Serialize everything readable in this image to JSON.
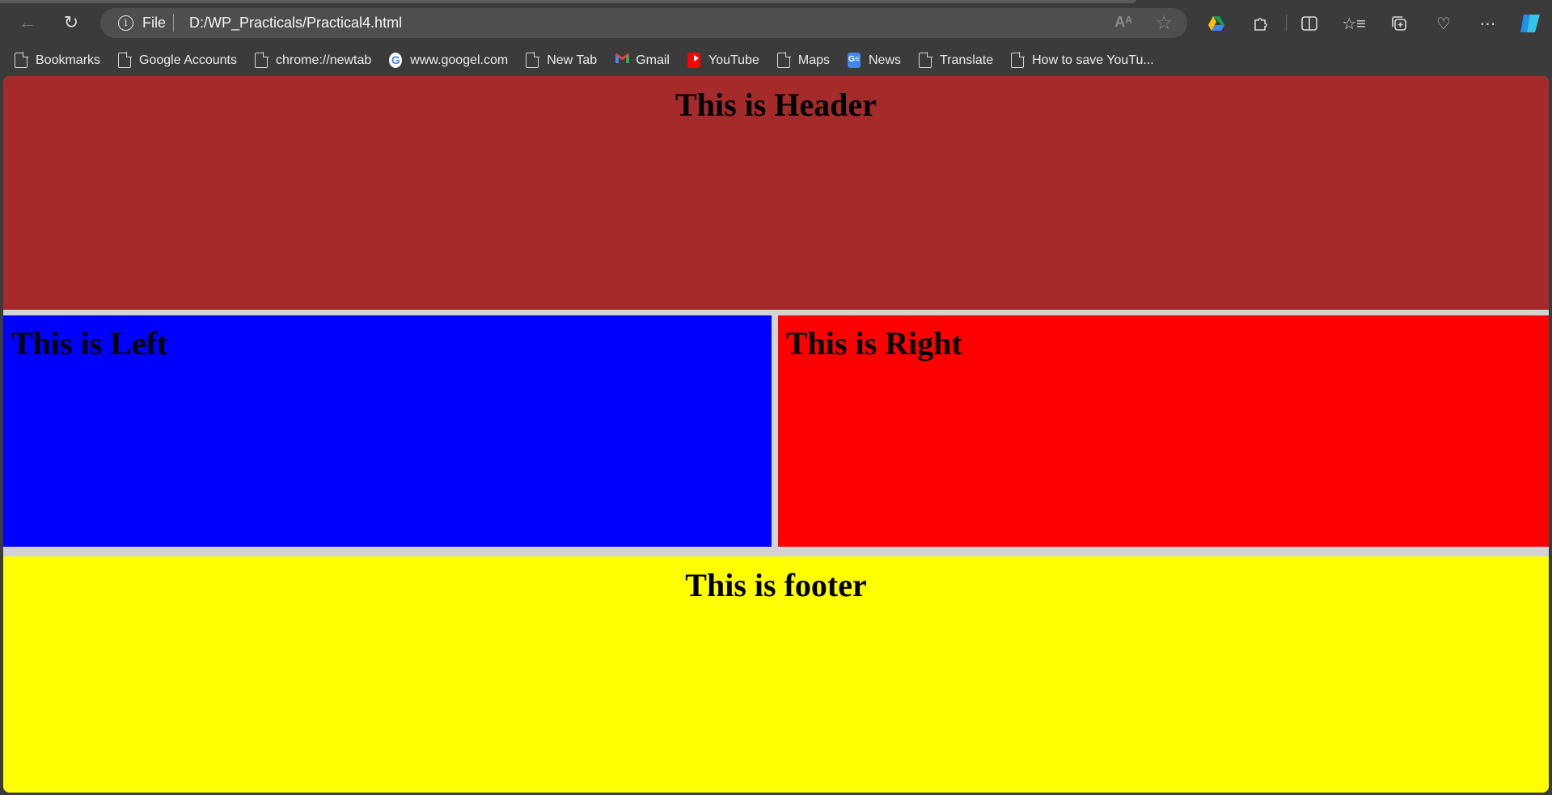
{
  "browser": {
    "address": {
      "scheme_label": "File",
      "url": "D:/WP_Practicals/Practical4.html"
    },
    "read_aloud_icon": "Aᴬ",
    "icons": [
      "back-icon",
      "reload-icon",
      "info-icon",
      "read-aloud-icon",
      "favorite-star-icon",
      "google-drive-icon",
      "extensions-icon",
      "split-screen-icon",
      "favorites-icon",
      "collections-icon",
      "browser-essentials-icon",
      "more-icon",
      "copilot-icon"
    ]
  },
  "bookmarks": [
    {
      "label": "Bookmarks",
      "icon": "document-icon"
    },
    {
      "label": "Google Accounts",
      "icon": "document-icon"
    },
    {
      "label": "chrome://newtab",
      "icon": "document-icon"
    },
    {
      "label": "www.googel.com",
      "icon": "google-icon"
    },
    {
      "label": "New Tab",
      "icon": "document-icon"
    },
    {
      "label": "Gmail",
      "icon": "gmail-icon"
    },
    {
      "label": "YouTube",
      "icon": "youtube-icon"
    },
    {
      "label": "Maps",
      "icon": "document-icon"
    },
    {
      "label": "News",
      "icon": "news-icon"
    },
    {
      "label": "Translate",
      "icon": "document-icon"
    },
    {
      "label": "How to save YouTu...",
      "icon": "document-icon"
    }
  ],
  "page": {
    "header": {
      "text": "This is Header",
      "color": "#a52a2a"
    },
    "left": {
      "text": "This is Left",
      "color": "#0000ff"
    },
    "right": {
      "text": "This is Right",
      "color": "#ff0000"
    },
    "footer": {
      "text": "This is footer",
      "color": "#ffff00"
    }
  }
}
